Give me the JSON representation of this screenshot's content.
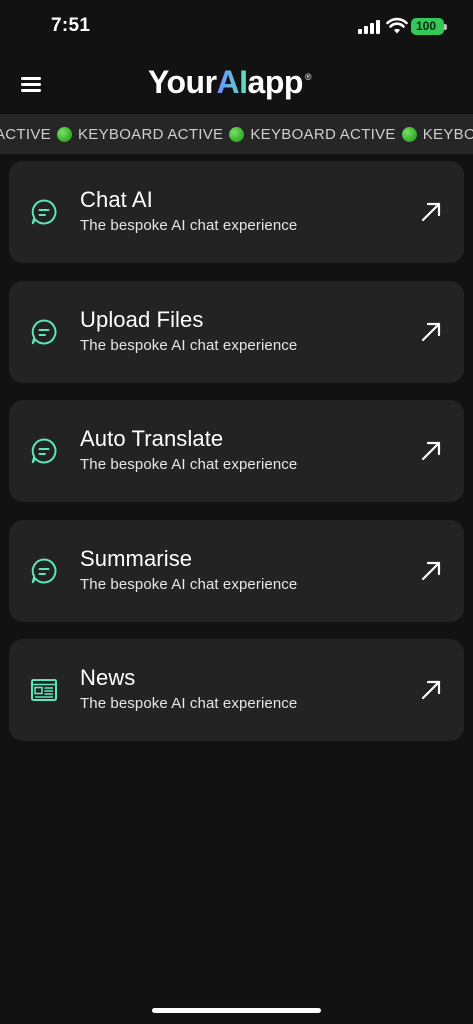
{
  "status_bar": {
    "time": "7:51",
    "battery_level": "100",
    "icons": [
      "signal-icon",
      "wifi-icon",
      "battery-icon"
    ]
  },
  "header": {
    "logo_part1": "Your",
    "logo_part2": "AI",
    "logo_part3": "app",
    "logo_reg": "®",
    "menu_icon": "hamburger-menu-icon"
  },
  "ticker": {
    "items": [
      "ACTIVE",
      "KEYBOARD ACTIVE",
      "KEYBOARD ACTIVE",
      "KEYBOA"
    ]
  },
  "cards": [
    {
      "title": "Chat AI",
      "subtitle": "The bespoke AI chat experience",
      "icon": "chat-bubble-icon"
    },
    {
      "title": "Upload Files",
      "subtitle": "The bespoke AI chat experience",
      "icon": "chat-bubble-icon"
    },
    {
      "title": "Auto Translate",
      "subtitle": "The bespoke AI chat experience",
      "icon": "chat-bubble-icon"
    },
    {
      "title": "Summarise",
      "subtitle": "The bespoke AI chat experience",
      "icon": "chat-bubble-icon"
    },
    {
      "title": "News",
      "subtitle": "The bespoke AI chat experience",
      "icon": "newspaper-icon"
    }
  ],
  "colors": {
    "background": "#121212",
    "card": "#232323",
    "ticker_bg": "#262626",
    "accent_green": "#5ee6b6",
    "battery_green": "#34c759"
  }
}
